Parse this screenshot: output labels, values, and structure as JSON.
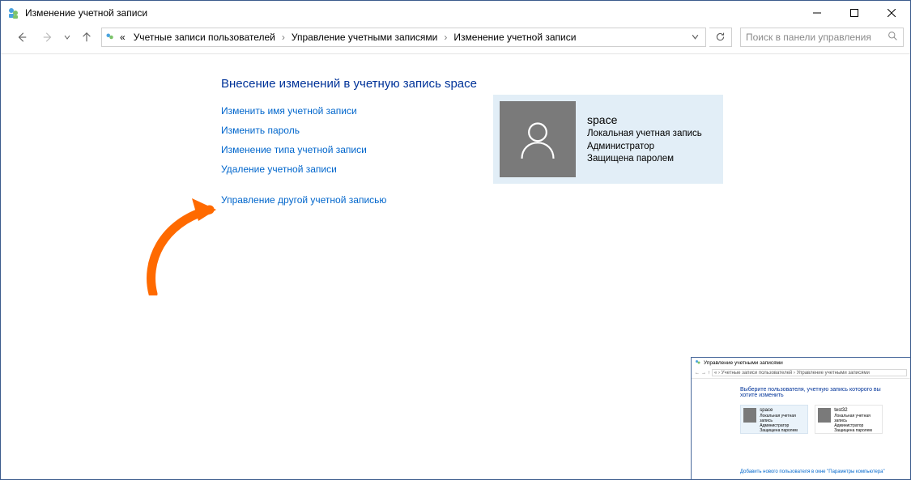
{
  "window": {
    "title": "Изменение учетной записи"
  },
  "breadcrumbs": {
    "prefix": "«",
    "items": [
      "Учетные записи пользователей",
      "Управление учетными записями",
      "Изменение учетной записи"
    ]
  },
  "search": {
    "placeholder": "Поиск в панели управления"
  },
  "main": {
    "heading": "Внесение изменений в учетную запись space",
    "links": {
      "rename": "Изменить имя учетной записи",
      "password": "Изменить пароль",
      "type": "Изменение типа учетной записи",
      "delete": "Удаление учетной записи",
      "manage_other": "Управление другой учетной записью"
    }
  },
  "account": {
    "name": "space",
    "kind": "Локальная учетная запись",
    "role": "Администратор",
    "protection": "Защищена паролем"
  },
  "thumb": {
    "title": "Управление учетными записями",
    "breadcrumb": "« › Учетные записи пользователей › Управление учетными записями",
    "heading": "Выберите пользователя, учетную запись которого вы хотите изменить",
    "user1": {
      "name": "space",
      "kind": "Локальная учетная запись",
      "role": "Администратор",
      "prot": "Защищена паролем"
    },
    "user2": {
      "name": "test32",
      "kind": "Локальная учетная запись",
      "role": "Администратор",
      "prot": "Защищена паролем"
    },
    "footer": "Добавить нового пользователя в окне \"Параметры компьютера\""
  }
}
